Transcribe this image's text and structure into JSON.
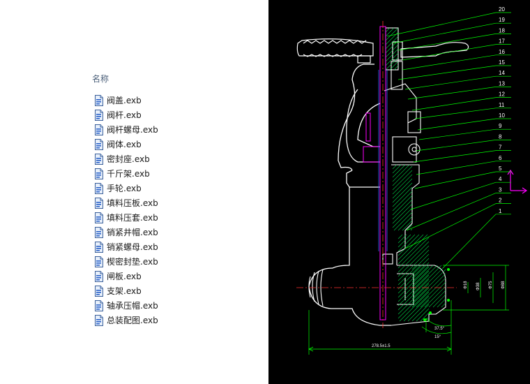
{
  "explorer": {
    "column_header": "名称",
    "files": [
      {
        "name": "阀盖.exb"
      },
      {
        "name": "阀杆.exb"
      },
      {
        "name": "阀杆螺母.exb"
      },
      {
        "name": "阀体.exb"
      },
      {
        "name": "密封座.exb"
      },
      {
        "name": "千斤架.exb"
      },
      {
        "name": "手轮.exb"
      },
      {
        "name": "填料压板.exb"
      },
      {
        "name": "填料压套.exb"
      },
      {
        "name": "销紧井帽.exb"
      },
      {
        "name": "销紧螺母.exb"
      },
      {
        "name": "楔密封垫.exb"
      },
      {
        "name": "闸板.exb"
      },
      {
        "name": "支架.exb"
      },
      {
        "name": "轴承压帽.exb"
      },
      {
        "name": "总装配图.exb"
      }
    ],
    "file_icon": "document-icon"
  },
  "preview": {
    "background": "#000000",
    "balloon_color": "#00ff00",
    "axis_color": "#ff00ff",
    "part_labels": [
      "20",
      "19",
      "18",
      "17",
      "16",
      "15",
      "14",
      "13",
      "12",
      "11",
      "10",
      "9",
      "8",
      "7",
      "6",
      "5",
      "4",
      "3",
      "2",
      "1"
    ],
    "dimensions": {
      "bottom": "278.5±1.5",
      "right_1": "Φ88",
      "right_2": "Φ75",
      "right_3": "Φ38",
      "right_4": "Φ18",
      "angle_1": "37.5°",
      "angle_2": "15°"
    }
  }
}
